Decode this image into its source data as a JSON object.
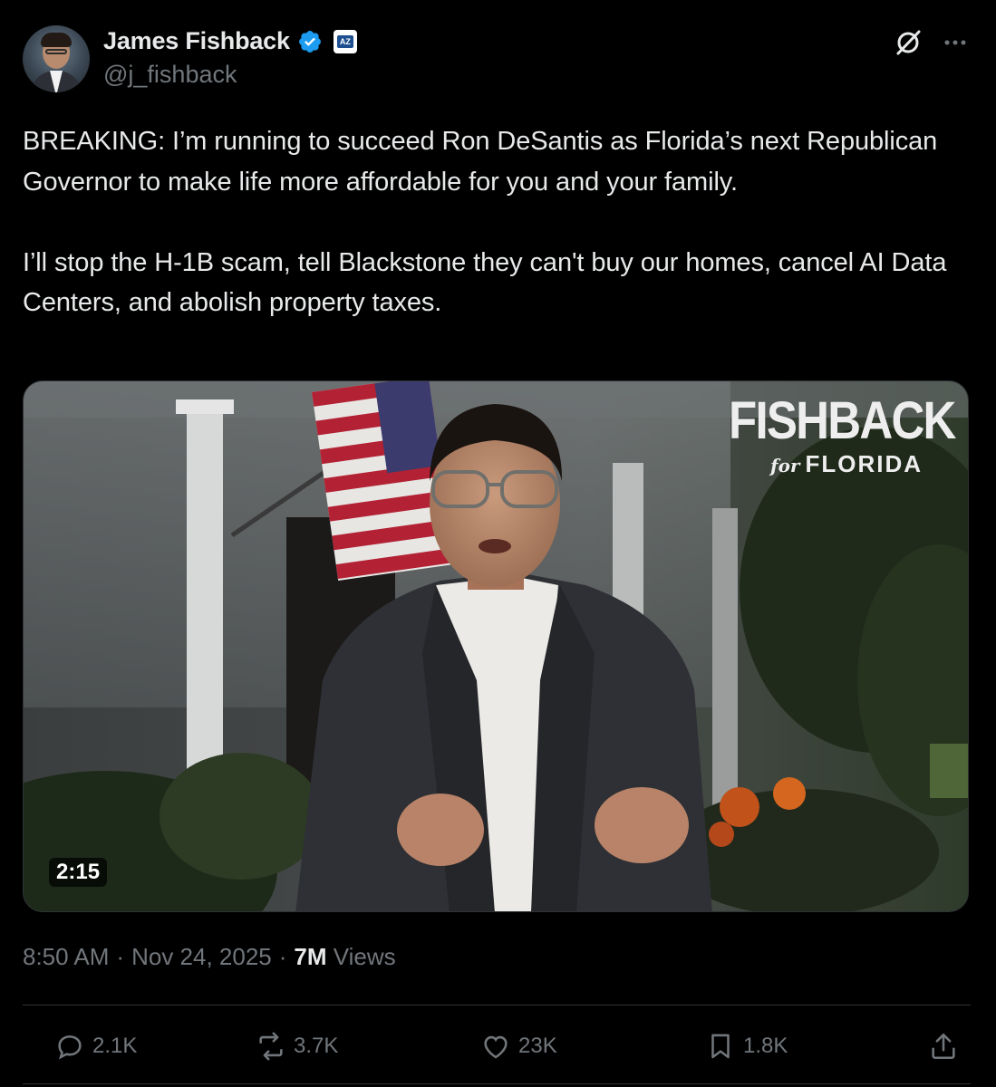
{
  "author": {
    "display_name": "James Fishback",
    "handle": "@j_fishback",
    "verified": true,
    "affiliation_badge": "AZ"
  },
  "tweet": {
    "text": "BREAKING: I’m running to succeed Ron DeSantis as Florida’s next Republican Governor to make life more affordable for you and your family.\n\nI’ll stop the H-1B scam, tell Blackstone they can't buy our homes, cancel AI Data Centers, and abolish property taxes."
  },
  "media": {
    "type": "video",
    "duration": "2:15",
    "overlay_logo": {
      "main": "FISHBACK",
      "for": "for",
      "state": "FLORIDA"
    }
  },
  "meta": {
    "time": "8:50 AM",
    "separator": "·",
    "date": "Nov 24, 2025",
    "views_count": "7M",
    "views_label": "Views"
  },
  "actions": {
    "replies": "2.1K",
    "reposts": "3.7K",
    "likes": "23K",
    "bookmarks": "1.8K"
  },
  "icons": {
    "header": [
      "grok-icon",
      "more-icon"
    ],
    "actions": [
      "reply-icon",
      "repost-icon",
      "like-icon",
      "bookmark-icon",
      "share-icon"
    ]
  },
  "colors": {
    "background": "#000000",
    "text": "#e7e9ea",
    "secondary": "#71767b",
    "verified_blue": "#1d9bf0",
    "divider": "#2f3336"
  }
}
